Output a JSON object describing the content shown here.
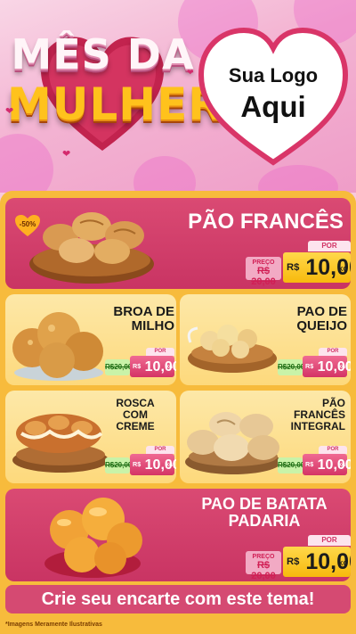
{
  "header": {
    "title_line1": "MÊS DA",
    "title_line2": "MULHER",
    "logo_line1": "Sua Logo",
    "logo_line2": "Aqui"
  },
  "badge": {
    "discount": "-50%"
  },
  "products": [
    {
      "name": "PÃO FRANCÊS",
      "por": "POR",
      "preco_label": "PREÇO",
      "old_price": "R$ 20,00",
      "currency": "R$",
      "price": "10,00",
      "unit": "KG"
    },
    {
      "name_line1": "BROA DE",
      "name_line2": "MILHO",
      "por": "POR",
      "old_price": "R$20,00",
      "currency": "R$",
      "price": "10,00",
      "unit": "KG"
    },
    {
      "name_line1": "PAO DE",
      "name_line2": "QUEIJO",
      "por": "POR",
      "old_price": "R$20,00",
      "currency": "R$",
      "price": "10,00",
      "unit": "KG"
    },
    {
      "name_line1": "ROSCA",
      "name_line2": "COM",
      "name_line3": "CREME",
      "por": "POR",
      "old_price": "R$20,00",
      "currency": "R$",
      "price": "10,00",
      "unit": "KG"
    },
    {
      "name_line1": "PÃO",
      "name_line2": "FRANCÊS",
      "name_line3": "INTEGRAL",
      "por": "POR",
      "old_price": "R$20,00",
      "currency": "R$",
      "price": "10,00",
      "unit": "KG"
    },
    {
      "name_line1": "PAO DE BATATA",
      "name_line2": "PADARIA",
      "por": "POR",
      "preco_label": "PREÇO",
      "old_price": "R$ 20,00",
      "currency": "R$",
      "price": "10,00",
      "unit": "KG"
    }
  ],
  "cta": "Crie seu encarte com este tema!",
  "footnote": "*Imagens Meramente Ilustrativas",
  "colors": {
    "red_card": "#cf3a68",
    "yellow_card": "#fddb84",
    "board": "#f7bb3c",
    "price_gold": "#f7b90d"
  }
}
